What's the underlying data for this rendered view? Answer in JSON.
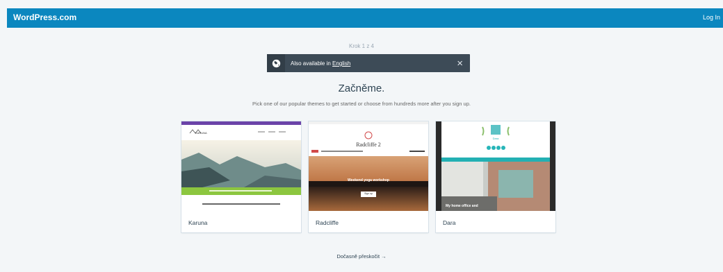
{
  "header": {
    "brand": "WordPress.com",
    "login": "Log In"
  },
  "step": "Krok 1 z 4",
  "notice": {
    "icon": "globe-icon",
    "text": "Also available in",
    "link": "English",
    "close": "×"
  },
  "main": {
    "title": "Začněme.",
    "subtitle": "Pick one of our popular themes to get started or choose from hundreds more after you sign up."
  },
  "themes": [
    {
      "name": "Karuna",
      "preview": {
        "logo": "KARUNA",
        "banner": "Welcome to Karuna Yoga",
        "tagline": "Welcome to Karuna Yoga. Compassion-based education and practice"
      }
    },
    {
      "name": "Radcliffe",
      "preview": {
        "logo": "Radcliffe 2",
        "hero": "Weekend yoga workshop",
        "button": "Sign up"
      }
    },
    {
      "name": "Dara",
      "preview": {
        "logo": "Dara",
        "overlay": "My home office and"
      }
    }
  ],
  "skip": {
    "label": "Dočasně přeskočit",
    "arrow": "→"
  },
  "colors": {
    "brand": "#0b87bf",
    "notice": "#3d4b57",
    "background": "#f3f6f8"
  }
}
